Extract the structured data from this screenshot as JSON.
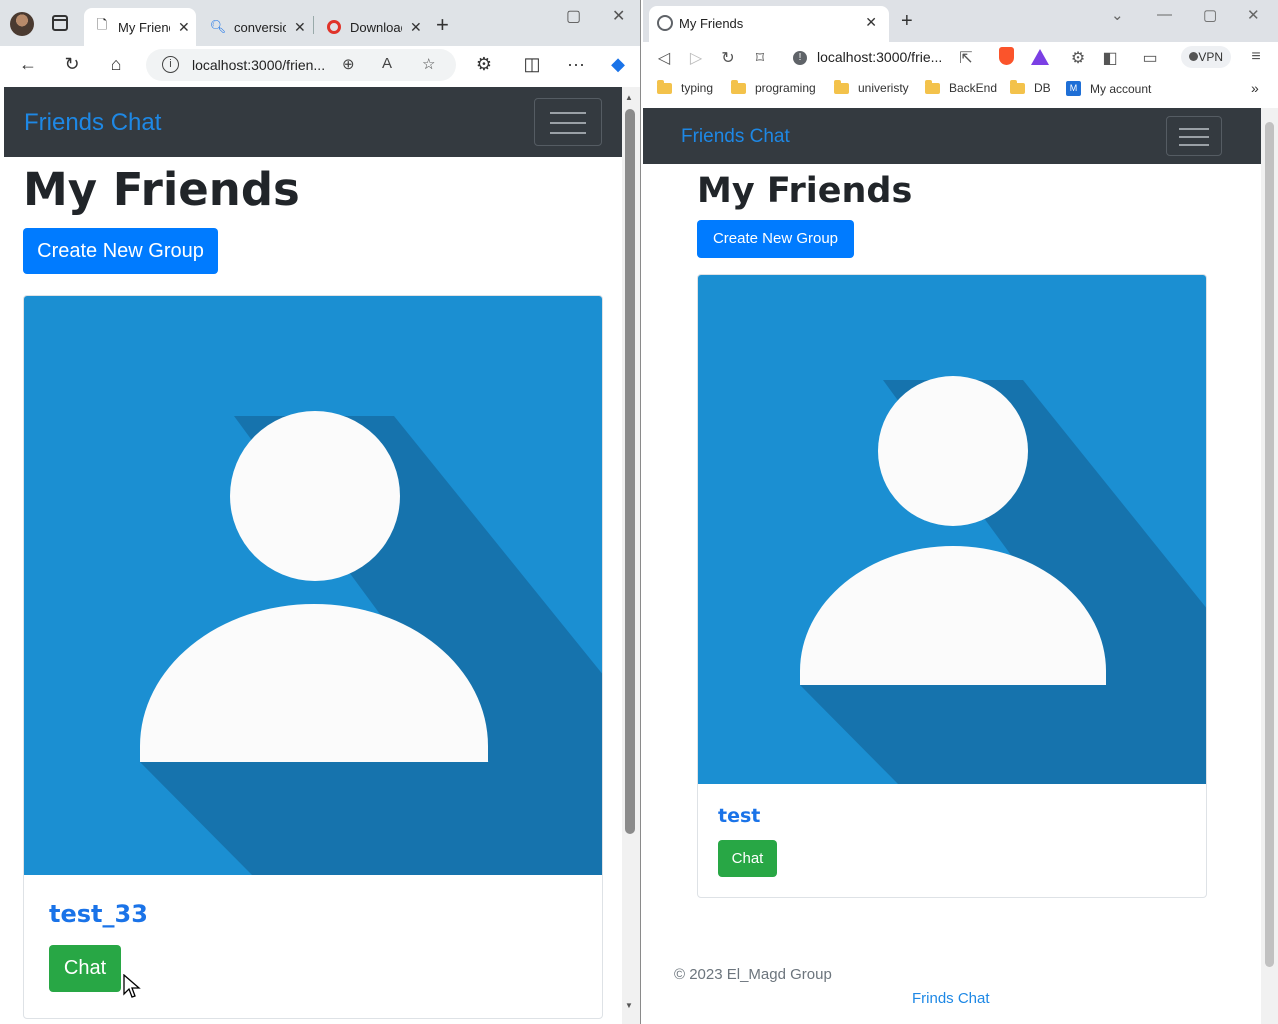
{
  "left_browser": {
    "tabs": [
      {
        "title": "My Friends",
        "favicon": "page-icon"
      },
      {
        "title": "conversion",
        "favicon": "search-icon"
      },
      {
        "title": "Downloads",
        "favicon": "opera-icon"
      }
    ],
    "url": "localhost:3000/frien...",
    "page": {
      "brand": "Friends Chat",
      "title": "My Friends",
      "create_group_label": "Create New Group",
      "friend_name": "test_33",
      "chat_label": "Chat"
    }
  },
  "right_browser": {
    "tab_title": "My Friends",
    "url": "localhost:3000/frie...",
    "vpn_label": "VPN",
    "bookmarks": [
      {
        "label": "typing",
        "icon": "folder-icon"
      },
      {
        "label": "programing",
        "icon": "folder-icon"
      },
      {
        "label": "univeristy",
        "icon": "folder-icon"
      },
      {
        "label": "BackEnd",
        "icon": "folder-icon"
      },
      {
        "label": "DB",
        "icon": "folder-icon"
      },
      {
        "label": "My account",
        "icon": "ms-account-icon"
      }
    ],
    "page": {
      "brand": "Friends Chat",
      "title": "My Friends",
      "create_group_label": "Create New Group",
      "friend_name": "test",
      "chat_label": "Chat",
      "footer_copyright": "© 2023 El_Magd Group",
      "footer_link": "Frinds Chat"
    }
  },
  "colors": {
    "navbar": "#343a40",
    "brand": "#1e88e5",
    "primary": "#007bff",
    "success": "#28a745",
    "avatar_bg": "#1b8fd2",
    "avatar_shadow": "#1673ad"
  }
}
